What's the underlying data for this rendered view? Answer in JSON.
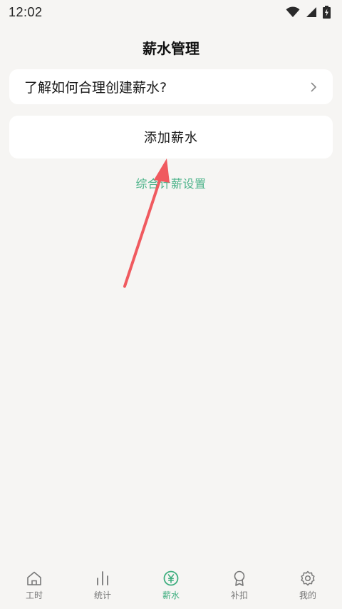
{
  "status_bar": {
    "time": "12:02",
    "icons": [
      "wifi-icon",
      "signal-icon",
      "battery-charging-icon"
    ]
  },
  "header": {
    "title": "薪水管理"
  },
  "guide": {
    "label": "了解如何合理创建薪水?",
    "icon": "chevron-right-icon"
  },
  "add_salary": {
    "label": "添加薪水"
  },
  "settings_link": {
    "label": "综合计薪设置"
  },
  "annotation": {
    "type": "red-arrow",
    "color": "#f05a5f"
  },
  "bottom_nav": {
    "active_color": "#3fae7f",
    "items": [
      {
        "label": "工时",
        "icon": "home-icon"
      },
      {
        "label": "统计",
        "icon": "bar-chart-icon"
      },
      {
        "label": "薪水",
        "icon": "yen-coin-icon",
        "active": true
      },
      {
        "label": "补扣",
        "icon": "award-icon"
      },
      {
        "label": "我的",
        "icon": "gear-icon"
      }
    ]
  }
}
